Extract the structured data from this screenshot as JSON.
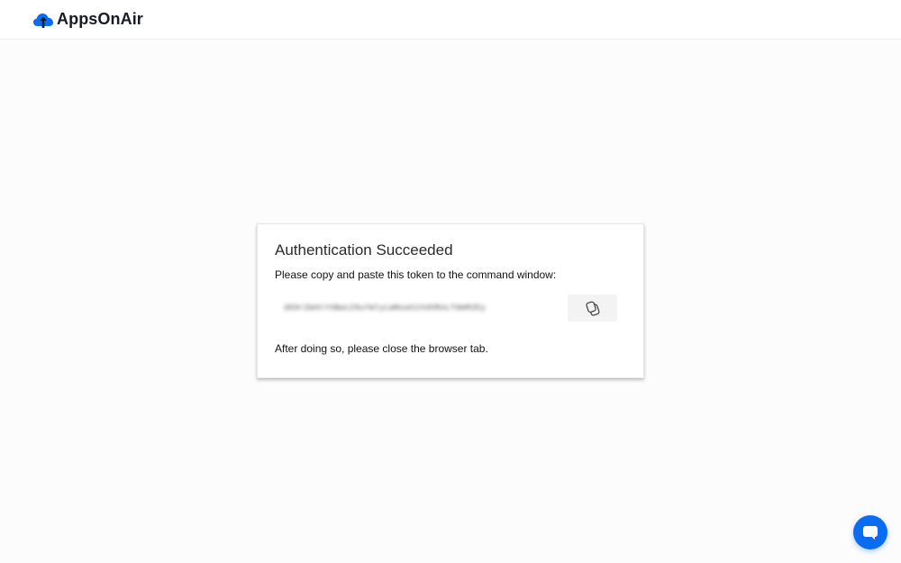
{
  "header": {
    "brand_name": "AppsOnAir",
    "logo_icon": "cloud-upload-icon"
  },
  "auth_card": {
    "title": "Authentication Succeeded",
    "instruction": "Please copy and paste this token to the command window:",
    "token": "dG9rZW4tYXBwc29uYWlyLWNsaS1hdXRoLTdmM2Ey",
    "copy_icon": "copy-icon",
    "footer": "After doing so, please close the browser tab."
  },
  "chat": {
    "icon": "chat-bubble-icon"
  },
  "colors": {
    "brand_blue": "#0a6cf0",
    "brand_text": "#161b26",
    "copy_button_bg": "#f3f3f4"
  }
}
